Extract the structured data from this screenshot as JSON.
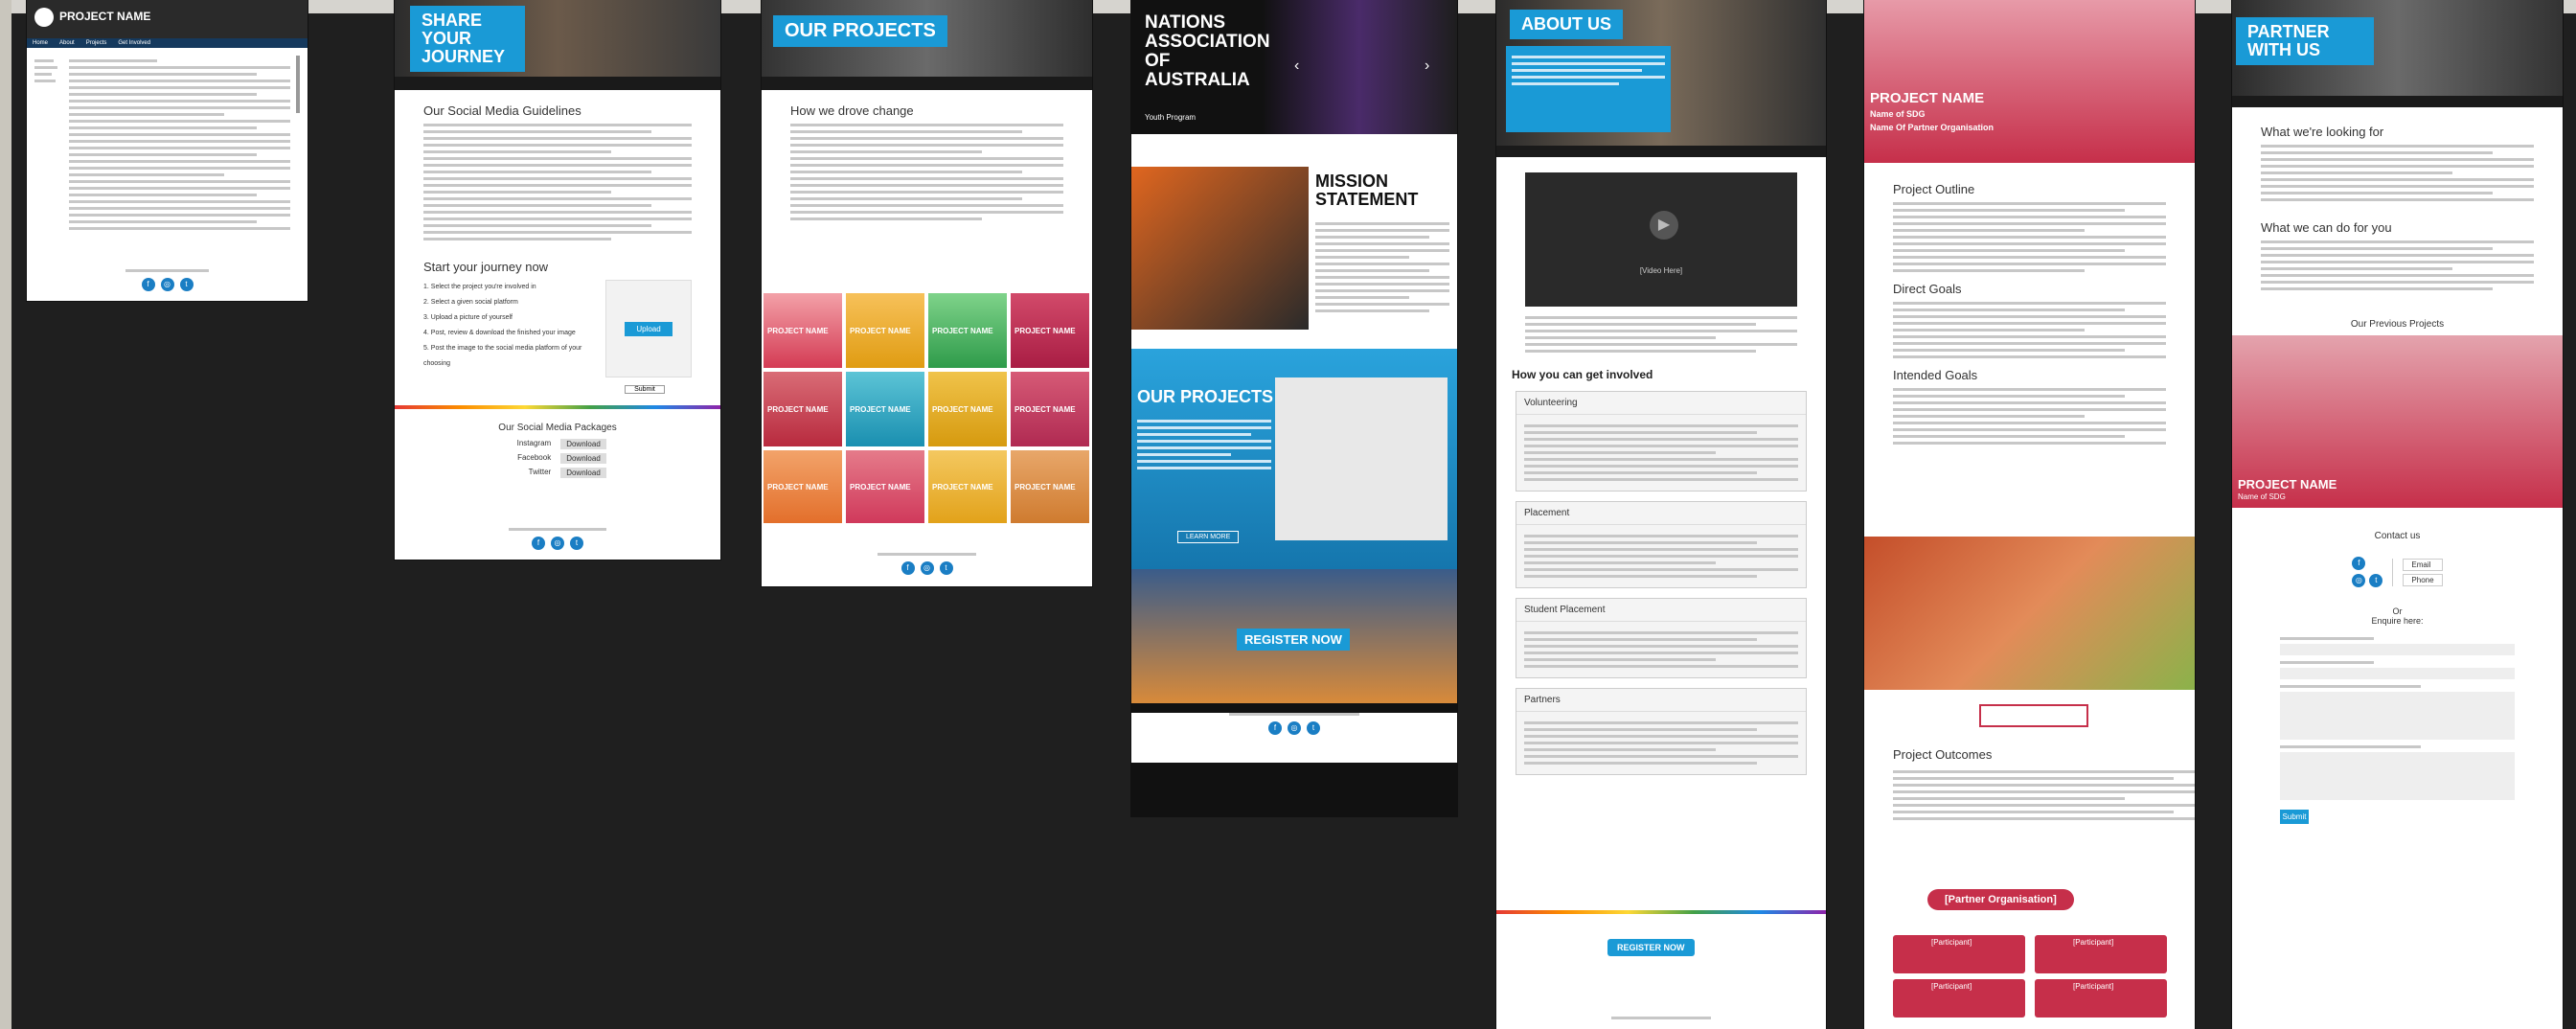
{
  "colors": {
    "brand_blue": "#1a9ad6",
    "pink": "#c62f4a",
    "dark": "#1f1f1f"
  },
  "board1": {
    "title": "PROJECT NAME",
    "nav": [
      "Home",
      "About",
      "Projects",
      "Get Involved"
    ]
  },
  "board2": {
    "hero": "SHARE YOUR JOURNEY",
    "h1": "Our Social Media Guidelines",
    "h2": "Start your journey now",
    "steps": [
      "1. Select the project you're involved in",
      "2. Select a given social platform",
      "3. Upload a picture of yourself",
      "4. Post, review & download the finished your image",
      "5. Post the image to the social media platform of your choosing"
    ],
    "upload_btn": "Upload",
    "submit_btn": "Submit",
    "pack_h": "Our Social Media Packages",
    "packs": [
      {
        "name": "Instagram",
        "btn": "Download"
      },
      {
        "name": "Facebook",
        "btn": "Download"
      },
      {
        "name": "Twitter",
        "btn": "Download"
      }
    ]
  },
  "board3": {
    "hero": "OUR PROJECTS",
    "h1": "How we drove change",
    "tiles": [
      "PROJECT NAME",
      "PROJECT NAME",
      "PROJECT NAME",
      "PROJECT NAME",
      "PROJECT NAME",
      "PROJECT NAME",
      "PROJECT NAME",
      "PROJECT NAME",
      "PROJECT NAME",
      "PROJECT NAME",
      "PROJECT NAME",
      "PROJECT NAME"
    ]
  },
  "board4": {
    "hero_title": "NATIONS ASSOCIATION OF AUSTRALIA",
    "hero_sub": "Youth Program",
    "mission": "MISSION STATEMENT",
    "projects": "OUR PROJECTS",
    "cta": "REGISTER NOW",
    "learn": "LEARN MORE"
  },
  "board5": {
    "hero": "ABOUT US",
    "video": "[Video Here]",
    "involved": "How you can get involved",
    "sections": [
      "Volunteering",
      "Placement",
      "Student Placement",
      "Partners"
    ],
    "cta": "REGISTER NOW"
  },
  "board6": {
    "hero_title": "PROJECT NAME",
    "hero_sub1": "Name of SDG",
    "hero_sub2": "Name Of Partner Organisation",
    "s1": "Project Outline",
    "s2": "Direct Goals",
    "s3": "Intended Goals",
    "s4": "Project Outcomes",
    "partner_btn": "[Partner Organisation]",
    "participants": [
      "[Participant]",
      "[Participant]",
      "[Participant]",
      "[Participant]"
    ]
  },
  "board7": {
    "hero": "PARTNER WITH US",
    "s1": "What we're looking for",
    "s2": "What we can do for you",
    "prev": "Our Previous Projects",
    "proj_title": "PROJECT NAME",
    "proj_sub": "Name of SDG",
    "contact": "Contact us",
    "email": "Email",
    "phone": "Phone",
    "or": "Or",
    "enquire": "Enquire here:",
    "submit": "Submit"
  }
}
